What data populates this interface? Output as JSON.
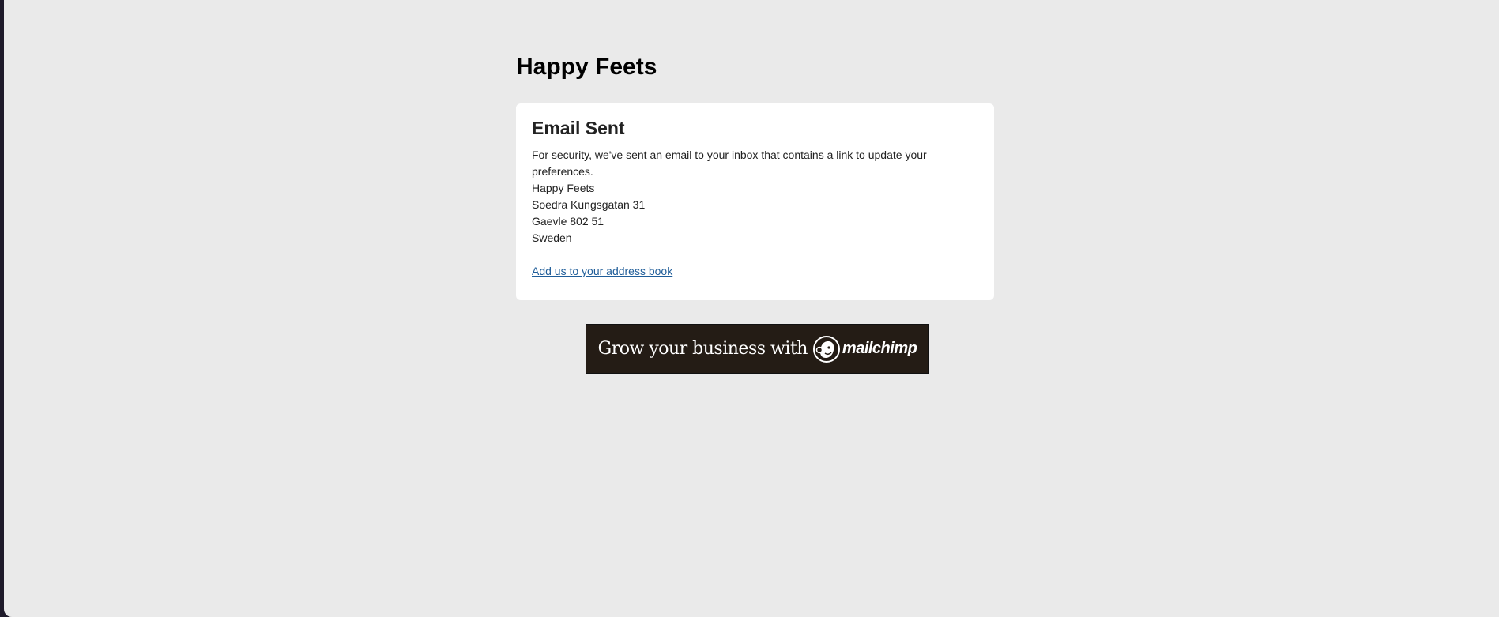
{
  "site": {
    "title": "Happy Feets"
  },
  "card": {
    "heading": "Email Sent",
    "message": "For security, we've sent an email to your inbox that contains a link to update your preferences.",
    "address": {
      "name": "Happy Feets",
      "street": "Soedra Kungsgatan 31",
      "city": "Gaevle 802 51",
      "country": "Sweden"
    },
    "address_book_link": "Add us to your address book"
  },
  "banner": {
    "tagline": "Grow your business with",
    "brand": "mailchimp",
    "logo_icon": "mailchimp-freddie-icon"
  },
  "colors": {
    "page_background": "#eaeaea",
    "card_background": "#ffffff",
    "link": "#1f5d99",
    "banner_background": "#241c15"
  }
}
